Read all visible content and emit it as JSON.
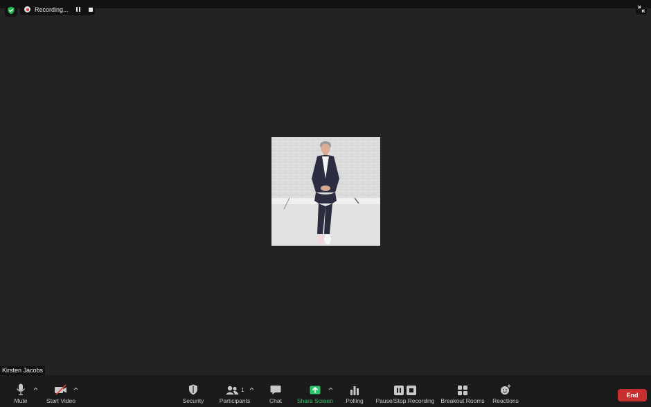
{
  "recording": {
    "status_label": "Recording..."
  },
  "participant": {
    "name": "Kirsten Jacobs"
  },
  "toolbar": {
    "mute_label": "Mute",
    "start_video_label": "Start Video",
    "security_label": "Security",
    "participants_label": "Participants",
    "participants_count": "1",
    "chat_label": "Chat",
    "share_screen_label": "Share Screen",
    "polling_label": "Polling",
    "pause_stop_recording_label": "Pause/Stop Recording",
    "breakout_rooms_label": "Breakout Rooms",
    "reactions_label": "Reactions",
    "end_label": "End"
  },
  "colors": {
    "background": "#232323",
    "toolbar": "#1a1a1a",
    "end_button": "#c8302f",
    "share_screen": "#2cc36b",
    "security_shield": "#23b551",
    "recording_dot": "#d23c3c",
    "video_off_slash": "#e0413a"
  }
}
